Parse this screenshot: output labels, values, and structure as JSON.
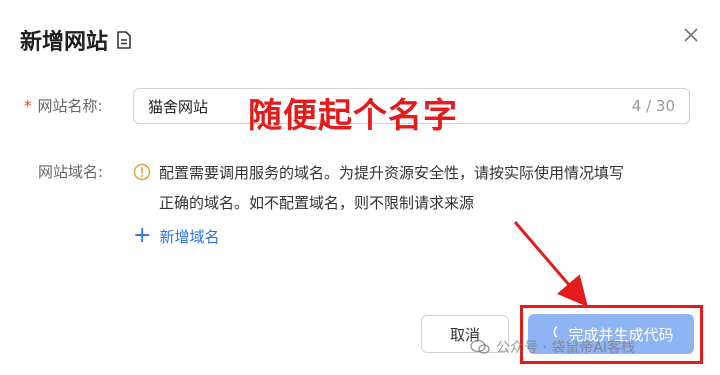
{
  "dialog": {
    "title": "新增网站",
    "name_field": {
      "label": "网站名称:",
      "value": "猫舍网站",
      "counter": "4 / 30"
    },
    "domain_field": {
      "label": "网站域名:",
      "notice_line1": "配置需要调用服务的域名。为提升资源安全性，请按实际使用情况填写",
      "notice_line2": "正确的域名。如不配置域名，则不限制请求来源",
      "add_domain_label": "新增域名"
    },
    "buttons": {
      "cancel_label": "取消",
      "confirm_label": "完成并生成代码"
    }
  },
  "annotation": {
    "text": "随便起个名字",
    "color": "#e31b1b"
  },
  "watermark": "公众号 · 袋鼠帝AI客栈",
  "colors": {
    "accent_blue": "#2b73e6",
    "primary_button_disabled": "#8fb4f4",
    "required_star": "#e53935",
    "info_icon": "#e8a33a"
  }
}
